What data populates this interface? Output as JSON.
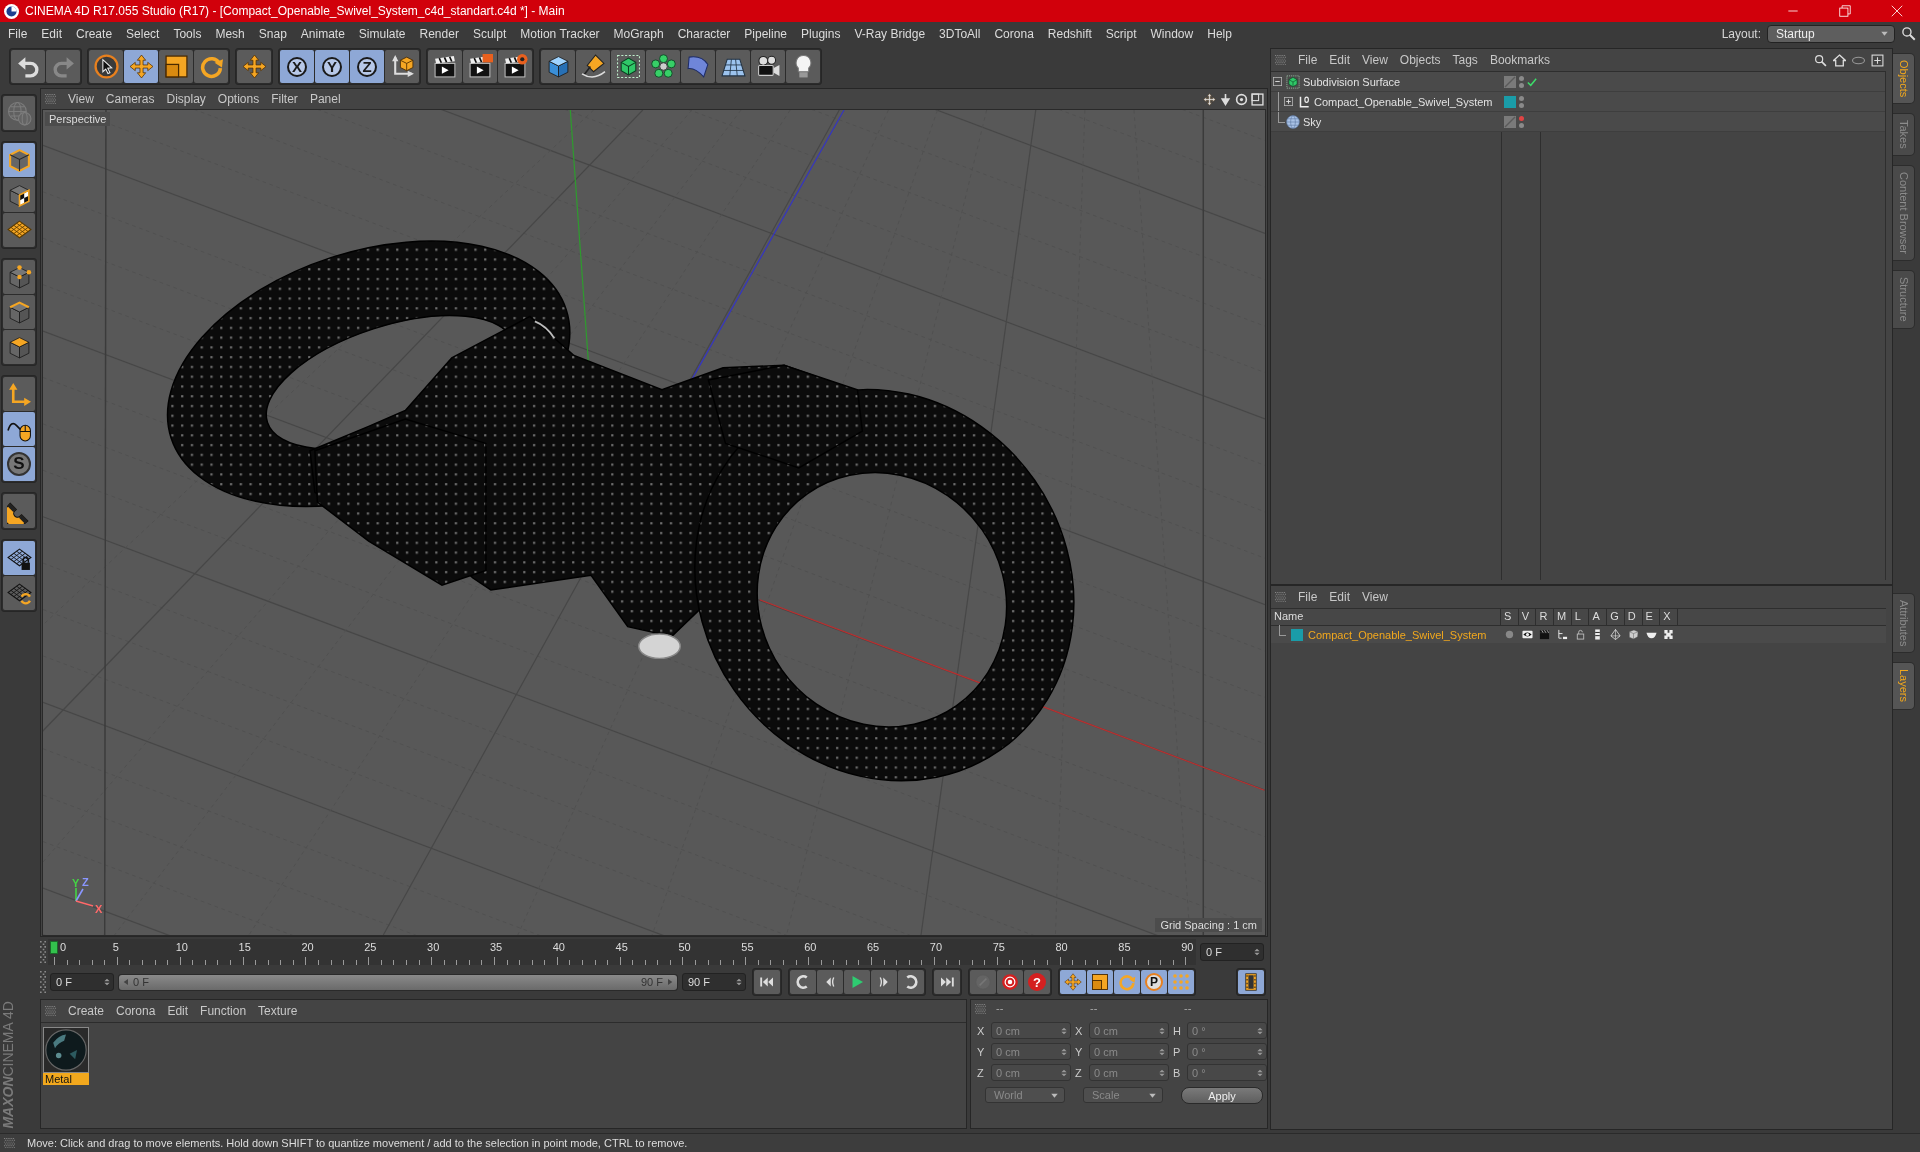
{
  "window": {
    "title": "CINEMA 4D R17.055 Studio (R17) - [Compact_Openable_Swivel_System_c4d_standart.c4d *] - Main"
  },
  "menu": [
    "File",
    "Edit",
    "Create",
    "Select",
    "Tools",
    "Mesh",
    "Snap",
    "Animate",
    "Simulate",
    "Render",
    "Sculpt",
    "Motion Tracker",
    "MoGraph",
    "Character",
    "Pipeline",
    "Plugins",
    "V-Ray Bridge",
    "3DToAll",
    "Corona",
    "Redshift",
    "Script",
    "Window",
    "Help"
  ],
  "layout": {
    "label": "Layout:",
    "value": "Startup"
  },
  "toolbar": [
    [
      {
        "kind": "undo",
        "active": false,
        "disabled": false
      },
      {
        "kind": "redo",
        "active": false,
        "disabled": true
      }
    ],
    [
      {
        "kind": "live-selection",
        "active": false,
        "disabled": false
      },
      {
        "kind": "move",
        "active": true,
        "disabled": false
      },
      {
        "kind": "scale",
        "active": false,
        "disabled": false
      },
      {
        "kind": "rotate",
        "active": false,
        "disabled": false
      }
    ],
    [
      {
        "kind": "last-tool",
        "active": false,
        "disabled": false
      }
    ],
    [
      {
        "kind": "axis-lock",
        "label": "X",
        "active": true,
        "disabled": false
      },
      {
        "kind": "axis-lock",
        "label": "Y",
        "active": true,
        "disabled": false
      },
      {
        "kind": "axis-lock",
        "label": "Z",
        "active": true,
        "disabled": false
      },
      {
        "kind": "coordinate-system",
        "active": false,
        "disabled": false
      }
    ],
    [
      {
        "kind": "render-view",
        "active": false,
        "disabled": false
      },
      {
        "kind": "render-picture-viewer",
        "active": false,
        "disabled": false
      },
      {
        "kind": "render-settings",
        "active": false,
        "disabled": false
      }
    ],
    [
      {
        "kind": "cube",
        "active": false,
        "disabled": false
      },
      {
        "kind": "pen",
        "active": false,
        "disabled": false
      },
      {
        "kind": "subdivision-surface",
        "active": false,
        "disabled": false
      },
      {
        "kind": "cloner",
        "active": false,
        "disabled": false
      },
      {
        "kind": "bend-deformer",
        "active": false,
        "disabled": false
      },
      {
        "kind": "floor",
        "active": false,
        "disabled": false
      },
      {
        "kind": "camera",
        "active": false,
        "disabled": false
      },
      {
        "kind": "light",
        "active": false,
        "disabled": false
      }
    ]
  ],
  "tools": [
    [
      {
        "kind": "make-editable",
        "active": false,
        "disabled": true
      }
    ],
    [
      {
        "kind": "model-mode",
        "active": true,
        "disabled": false
      },
      {
        "kind": "texture-mode",
        "active": false,
        "disabled": false
      },
      {
        "kind": "workplane-mode",
        "active": false,
        "disabled": false
      }
    ],
    [
      {
        "kind": "points-mode",
        "active": false,
        "disabled": false
      },
      {
        "kind": "edges-mode",
        "active": false,
        "disabled": false
      },
      {
        "kind": "polygons-mode",
        "active": false,
        "disabled": false
      }
    ],
    [
      {
        "kind": "axis-mode",
        "active": false,
        "disabled": false
      },
      {
        "kind": "tweak-mode",
        "active": true,
        "disabled": false
      },
      {
        "kind": "snap",
        "label": "S",
        "active": true,
        "disabled": false
      }
    ],
    [
      {
        "kind": "magnet",
        "active": false,
        "disabled": false
      }
    ],
    [
      {
        "kind": "lock-workplane",
        "active": true,
        "disabled": false
      },
      {
        "kind": "align-workplane",
        "active": false,
        "disabled": false
      }
    ]
  ],
  "logo": {
    "brand": "MAXON",
    "product": "CINEMA 4D"
  },
  "viewport": {
    "menu": [
      "View",
      "Cameras",
      "Display",
      "Options",
      "Filter",
      "Panel"
    ],
    "camera": "Perspective",
    "axis_gizmo": [
      "Y",
      "Z",
      "X"
    ],
    "grid_spacing": "Grid Spacing : 1 cm"
  },
  "timeline": {
    "labels": [
      "0",
      "5",
      "10",
      "15",
      "20",
      "25",
      "30",
      "35",
      "40",
      "45",
      "50",
      "55",
      "60",
      "65",
      "70",
      "75",
      "80",
      "85",
      "90"
    ],
    "playhead": {
      "level": 0
    },
    "frame": "0 F"
  },
  "transport": {
    "start": "0 F",
    "range": {
      "start": "0 F",
      "end": "90 F",
      "level": 1
    },
    "end": "90 F",
    "groups": [
      [
        {
          "kind": "go-to-start",
          "active": false,
          "disabled": false
        }
      ],
      [
        {
          "kind": "previous-key",
          "active": false,
          "disabled": false
        },
        {
          "kind": "previous-frame",
          "active": false,
          "disabled": false
        },
        {
          "kind": "play",
          "active": false,
          "disabled": false
        },
        {
          "kind": "next-frame",
          "active": false,
          "disabled": false
        },
        {
          "kind": "next-key",
          "active": false,
          "disabled": false
        }
      ],
      [
        {
          "kind": "go-to-end",
          "active": false,
          "disabled": false
        }
      ],
      [
        {
          "kind": "autokey",
          "active": false,
          "disabled": true
        },
        {
          "kind": "record",
          "active": false,
          "disabled": false
        },
        {
          "kind": "key-selection",
          "label": "?",
          "active": false,
          "disabled": false
        }
      ],
      [
        {
          "kind": "key-position",
          "active": true,
          "disabled": false
        },
        {
          "kind": "key-scale",
          "active": true,
          "disabled": false
        },
        {
          "kind": "key-rotation",
          "active": true,
          "disabled": false
        },
        {
          "kind": "key-parameter",
          "label": "P",
          "active": true,
          "disabled": false
        },
        {
          "kind": "key-pla",
          "active": true,
          "disabled": false
        }
      ],
      [
        {
          "kind": "timeline",
          "active": true,
          "disabled": false
        }
      ]
    ]
  },
  "materials": {
    "menu": [
      "Create",
      "Corona",
      "Edit",
      "Function",
      "Texture"
    ],
    "items": [
      {
        "name": "Metal",
        "selected": true
      }
    ]
  },
  "coordinates": {
    "disabled": true,
    "headers": [
      "--",
      "--",
      "--"
    ],
    "rows": [
      {
        "pos_axis": "X",
        "pos": "0 cm",
        "size_axis": "X",
        "size": "0 cm",
        "rot_axis": "H",
        "rot": "0 °"
      },
      {
        "pos_axis": "Y",
        "pos": "0 cm",
        "size_axis": "Y",
        "size": "0 cm",
        "rot_axis": "P",
        "rot": "0 °"
      },
      {
        "pos_axis": "Z",
        "pos": "0 cm",
        "size_axis": "Z",
        "size": "0 cm",
        "rot_axis": "B",
        "rot": "0 °"
      }
    ],
    "space": "World",
    "mode": "Scale",
    "apply": "Apply"
  },
  "status_bar": "Move: Click and drag to move elements. Hold down SHIFT to quantize movement / add to the selection in point mode, CTRL to remove.",
  "objects": {
    "menu": [
      "File",
      "Edit",
      "View",
      "Objects",
      "Tags",
      "Bookmarks"
    ],
    "tree": [
      {
        "name": "Subdivision Surface",
        "kind": "subdivision",
        "expanded": true,
        "enabled": true,
        "hidden_in_editor": false,
        "hidden_in_render": false,
        "children": [
          {
            "name": "Compact_Openable_Swivel_System",
            "kind": "null",
            "expanded": false,
            "color": "#1a9ca8",
            "hidden_in_editor": false,
            "hidden_in_render": false
          }
        ]
      },
      {
        "name": "Sky",
        "kind": "sky",
        "hidden_in_editor": true,
        "hidden_in_render": false
      }
    ]
  },
  "layers": {
    "menu": [
      "File",
      "Edit",
      "View"
    ],
    "columns": [
      "Name",
      "S",
      "V",
      "R",
      "M",
      "L",
      "A",
      "G",
      "D",
      "E",
      "X"
    ],
    "rows": [
      {
        "name": "Compact_Openable_Swivel_System",
        "color": "#1a9ca8"
      }
    ]
  },
  "side_tabs": {
    "top": [
      {
        "label": "Objects",
        "selected": true
      },
      {
        "label": "Takes",
        "selected": false
      },
      {
        "label": "Content Browser",
        "selected": false
      },
      {
        "label": "Structure",
        "selected": false
      }
    ],
    "bottom": [
      {
        "label": "Attributes",
        "selected": false
      },
      {
        "label": "Layers",
        "selected": true
      }
    ]
  }
}
